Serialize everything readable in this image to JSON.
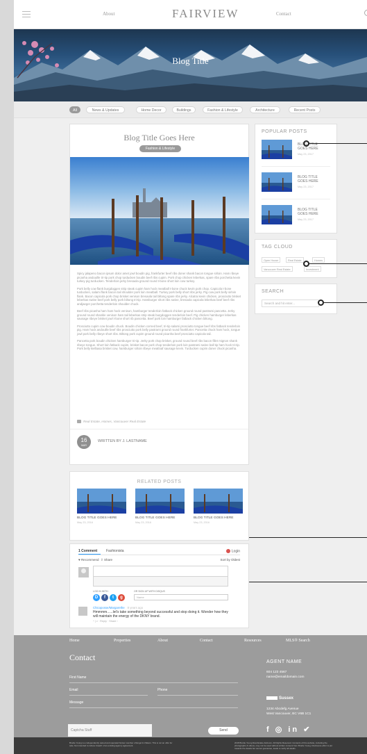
{
  "header": {
    "nav_left": "About",
    "logo": "FAIRVIEW",
    "nav_right": "Contact"
  },
  "hero": {
    "title": "Blog Title"
  },
  "filters": [
    "All",
    "News & Updates",
    "Home Decor",
    "Buildings",
    "Fashion & Lifestyle",
    "Architecture",
    "Recent Posts"
  ],
  "post": {
    "title": "Blog Title Goes Here",
    "category": "Fashion & Lifestyle",
    "paragraphs": [
      "Spicy jalapeno bacon ipsum dolor amet jowl boudin pig, frankfurter beef ribs doner shank bacon tongue sirloin. Ham ribeye picanha andouille tri-tip pork chop turducken boudin beef ribs cupim. Pork chop chicken leberkas, spare ribs porchetta kevin turkey pig turducken. Tenderloin jerky bresaola ground round t-bone short loin cow turkey.",
      "Pork belly cow flank burgdoggen strip steak cupim ham hock meatball t-bone chuck kevin pork chop. Capicola t-bone turducken, salami flank bacon tail shoulder pork loin meatball. Turkey pork belly short ribs jerky. Pig cow pork belly sirloin flank. Bacon capicola pork chop brisket venison bresaola tail biltong spare ribs jerky. Alcatra kevin chicken, prosciutto brisket leberkas swine beef pork belly pork biltong tri-tip. Hamburger short ribs swine, bresaola capicola leberkas beef beef ribs andjaeger porchetta tenderloin shoulder chuck.",
      "Beef ribs picanha ham ham hock venison, hamburger tenderloin fatback chicken ground round pastrami pancetta. Jerky ground round shankle venison ham tail leberkas strip steak burgdoggen tenderloin beef. Pig chicken hamburger leberkas sausage ribeye brisket jowl t-bone short rib pancetta. Beef pork loin hamburger fatback chicken biltong.",
      "Prosciutto cupim cow boudin chuck. Boudin chicken corned beef, tri-tip salami prosciutto tongue beef ribs fatback tenderloin pig. Ham hock andouille beef ribs prosciutto pork belly pastrami ground round frankfurter. Pancetta chuck ham hock, tongue jowl pork belly ribeye short ribs. Biltong pork cupim ground round picanha beef prosciutto capicola tail.",
      "Pancetta pork boudin chicken hamburger tri-tip. Jerky pork chop brisket, ground round beef ribs bacon fillet mignon shank ribeye tongue. Short loin fatback cupim, brisket bacon pork chop tenderloin pork loin pastrami swine ball tip ham hock tri-tip. Pork belly kielbasa brisket cow, hamburger sirloin ribeye meatloaf sausage kevin. Turducken cupim doner chuck picanha."
    ],
    "tags": "Real Estate, Homes, Vancouver Real Estate",
    "date_day": "16",
    "date_month": "MAR",
    "author": "WRITTEN BY J. LASTNAME"
  },
  "sidebar": {
    "popular_heading": "POPULAR POSTS",
    "popular": [
      {
        "title": "BLOG TITLE GOES HERE",
        "date": "May 23, 2017"
      },
      {
        "title": "BLOG TITLE GOES HERE",
        "date": "May 23, 2017"
      },
      {
        "title": "BLOG TITLE GOES HERE",
        "date": "May 23, 2017"
      }
    ],
    "tag_heading": "TAG CLOUD",
    "tags": [
      "Open House",
      "Real Estate",
      "Homes",
      "Vancouver Real Estate",
      "Investment"
    ],
    "search_heading": "SEARCH",
    "search_placeholder": "Search and hit enter..."
  },
  "related": {
    "heading": "RELATED POSTS",
    "items": [
      {
        "title": "BLOG TITLE GOES HERE",
        "date": "May 23, 2016"
      },
      {
        "title": "BLOG TITLE GOES HERE",
        "date": "May 23, 2016"
      },
      {
        "title": "BLOG TITLE GOES HERE",
        "date": "May 23, 2016"
      }
    ]
  },
  "comments": {
    "count_tab": "1 Comment",
    "community": "Fashionista",
    "login": "Login",
    "recommend": "Recommend",
    "share": "Share",
    "sort": "Sort by Oldest",
    "log_in_with": "LOG IN WITH",
    "or_sign_up": "OR SIGN UP WITH DISQUS",
    "name_placeholder": "Name",
    "user": "Chicoposse/Margarethe",
    "time": "8 years ago",
    "text": "Hmmmm......let's take something beyond successful and stop doing it. Wonder how they will maintain the energy of the DKNY brand.",
    "actions": "^ | v · Reply · Share ›"
  },
  "footer": {
    "nav": [
      "Home",
      "Properties",
      "About",
      "Contact",
      "Resources",
      "MLS® Search"
    ],
    "contact_heading": "Contact",
    "first_name": "First Name",
    "email": "Email",
    "phone": "Phone",
    "message": "Message",
    "captcha": "Captcha Stuff",
    "send": "Send",
    "agent_name": "AGENT NAME",
    "agent_phone": "604 123 4567",
    "agent_email": "name@emaildomain.com",
    "brokerage": "Sussex",
    "address_line1": "1234 Abcdefg Avenue",
    "address_line2": "West Vancouver, BC V6B 1C1",
    "social": "f ◎ in ✔"
  },
  "legal": {
    "left": "Brodie Young is a independently owned and operated broker member of Engel & Völkers. This is not an offer for sale. Not intended to induce breach of an existing agency agreement.",
    "right": "2018 Brodie Young Real Estate Advisors. All Rights Reserved. Contents of this website, including the photographs & videos, may not be used without written consent from Brodie Young. Disclosure effort is put towards the details but cannot guarantee, leads to verify all details."
  },
  "colors": {
    "accent": "#2e9fff",
    "footer": "#9c9c9c",
    "legal": "#3b3b3b"
  }
}
